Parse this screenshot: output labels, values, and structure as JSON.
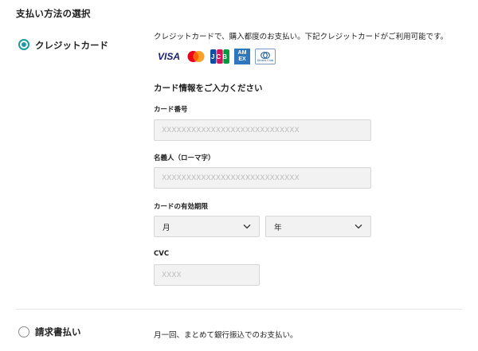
{
  "section_title": "支払い方法の選択",
  "credit": {
    "label": "クレジットカード",
    "description": "クレジットカードで、購入都度のお支払い。下記クレジットカードがご利用可能です。",
    "brands": {
      "visa": "VISA",
      "jcb": "JCB",
      "amex_top": "AM",
      "amex_bottom": "EX",
      "diners": "Diners Club"
    },
    "card_info_heading": "カード情報をご入力ください",
    "card_number_label": "カード番号",
    "card_number_placeholder": "XXXXXXXXXXXXXXXXXXXXXXXXXXXX",
    "name_label": "名義人（ローマ字）",
    "name_placeholder": "XXXXXXXXXXXXXXXXXXXXXXXXXXXX",
    "expiry_label": "カードの有効期限",
    "month_value": "月",
    "year_value": "年",
    "cvc_label": "CVC",
    "cvc_placeholder": "XXXX"
  },
  "invoice": {
    "label": "請求書払い",
    "description": "月一回、まとめて銀行振込でのお支払い。"
  },
  "colors": {
    "accent": "#1e9aa0",
    "visa": "#1a1f71",
    "mastercard_red": "#eb001b",
    "mastercard_orange": "#f79e1b",
    "amex": "#2e77bc"
  }
}
